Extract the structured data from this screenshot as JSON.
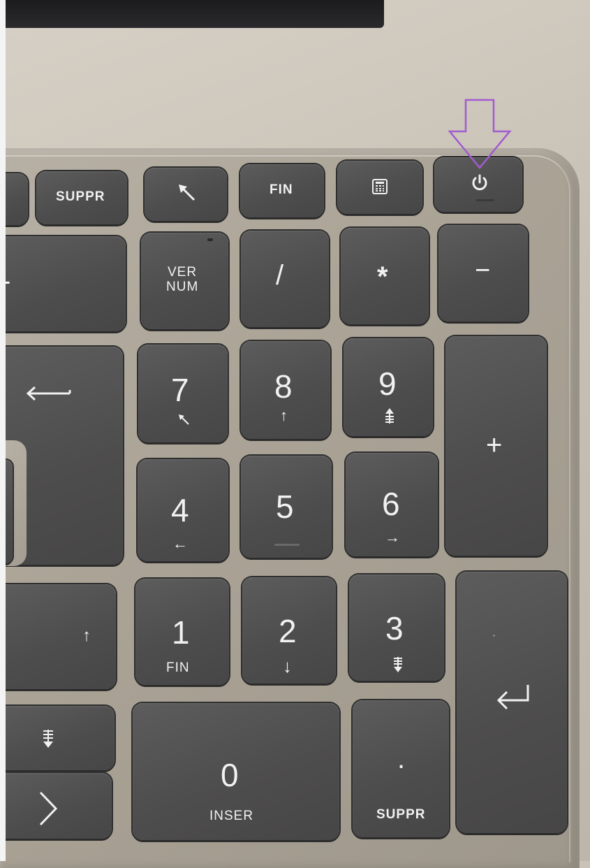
{
  "keys": {
    "suppr_top": "SUPPR",
    "fin_top": "FIN",
    "ver_num_line1": "VER",
    "ver_num_line2": "NUM",
    "slash": "/",
    "asterisk": "*",
    "minus": "−",
    "plus": "+",
    "k7": "7",
    "k8": "8",
    "k9": "9",
    "k4": "4",
    "k5": "5",
    "k6": "6",
    "k1": "1",
    "k1_sub": "FIN",
    "k2": "2",
    "k3": "3",
    "k0": "0",
    "k0_sub": "INSER",
    "dot": ".",
    "dot_sub": "SUPPR",
    "arrow_up": "↑",
    "arrow_down": "↓",
    "arrow_left": "←",
    "arrow_right": "→"
  },
  "icons": [
    "home-arrow-icon",
    "calculator-icon",
    "power-icon",
    "enter-icon",
    "page-up-icon",
    "page-down-icon",
    "chevron-right-icon"
  ],
  "annotation_color": "#a25bd0"
}
